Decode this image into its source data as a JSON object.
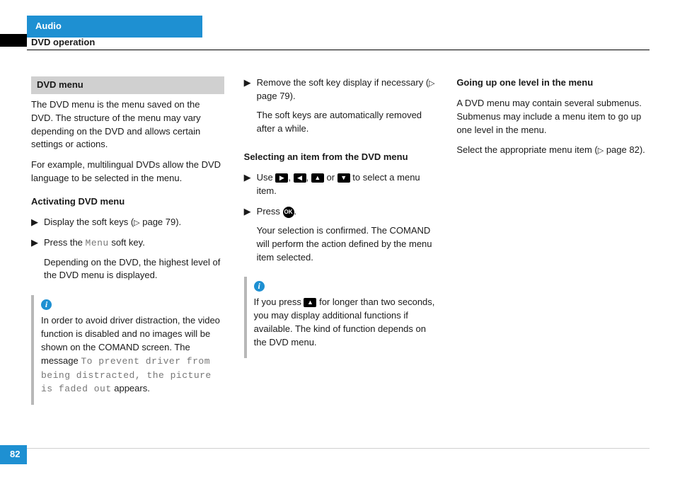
{
  "header": {
    "tab": "Audio",
    "sub": "DVD operation"
  },
  "page_number": "82",
  "grey_heading": "DVD menu",
  "intro1": "The DVD menu is the menu saved on the DVD. The structure of the menu may vary depending on the DVD and allows certain settings or actions.",
  "intro2": "For example, multilingual DVDs allow the DVD language to be selected in the menu.",
  "h_activate": "Activating DVD menu",
  "act1_a": "Display the soft keys (",
  "act1_b": " page 79).",
  "act2_a": "Press the ",
  "act2_mono": "Menu",
  "act2_b": " soft key.",
  "act2_sub": "Depending on the DVD, the highest level of the DVD menu is displayed.",
  "note1_a": "In order to avoid driver distraction, the video function is disabled and no images will be shown on the COMAND screen. The message ",
  "note1_mono": "To prevent driver from being distracted, the picture is faded out",
  "note1_b": " appears.",
  "rem_a": "Remove the soft key display if necessary (",
  "rem_b": " page 79).",
  "rem_sub": "The soft keys are automatically removed after a while.",
  "h_select": "Selecting an item from the DVD menu",
  "sel_a": "Use ",
  "sel_b": ", ",
  "sel_c": ", ",
  "sel_d": " or ",
  "sel_e": " to select a menu item.",
  "press_a": "Press ",
  "press_b": ".",
  "press_sub": "Your selection is confirmed. The COMAND will perform the action defined by the menu item selected.",
  "note2_a": "If you press ",
  "note2_b": " for longer than two seconds, you may display additional functions if available. The kind of function depends on the DVD menu.",
  "h_up": "Going up one level in the menu",
  "up1": "A DVD menu may contain several submenus. Submenus may include a menu item to go up one level in the menu.",
  "up2_a": "Select the appropriate menu item (",
  "up2_b": " page 82).",
  "glyph": {
    "tri": "▷",
    "step": "▶",
    "right": "▶",
    "left": "◀",
    "up": "▲",
    "down": "▼",
    "ok": "OK"
  }
}
